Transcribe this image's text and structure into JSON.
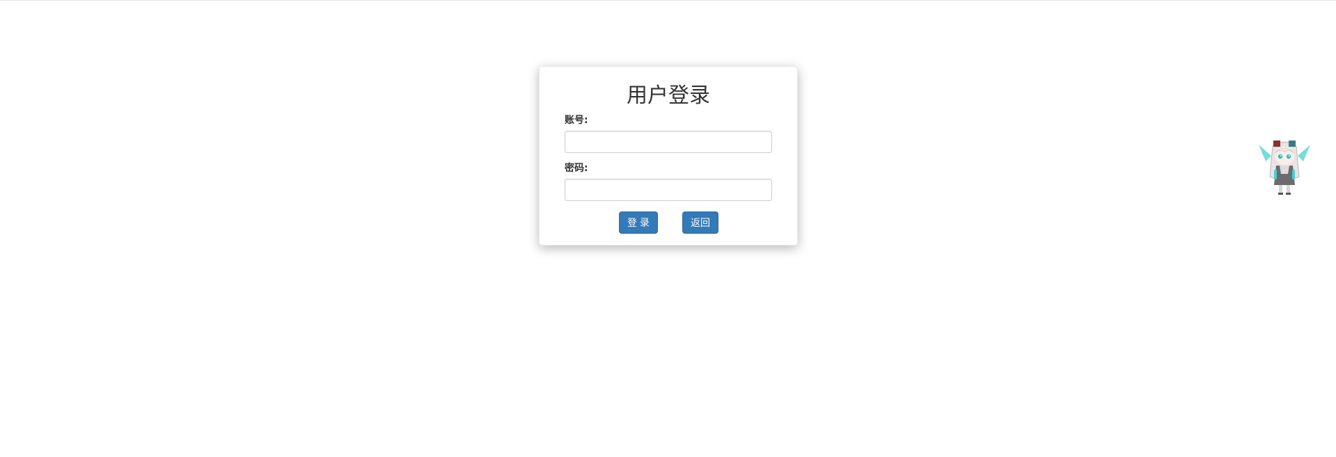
{
  "login": {
    "title": "用户登录",
    "account_label": "账号:",
    "account_value": "",
    "password_label": "密码:",
    "password_value": "",
    "login_button": "登 录",
    "back_button": "返回"
  },
  "mascot": {
    "icon": "anime-girl-mascot-icon"
  },
  "colors": {
    "primary_button": "#337ab7",
    "primary_button_border": "#2e6da4",
    "input_border": "#cccccc",
    "title_text": "#333333"
  }
}
